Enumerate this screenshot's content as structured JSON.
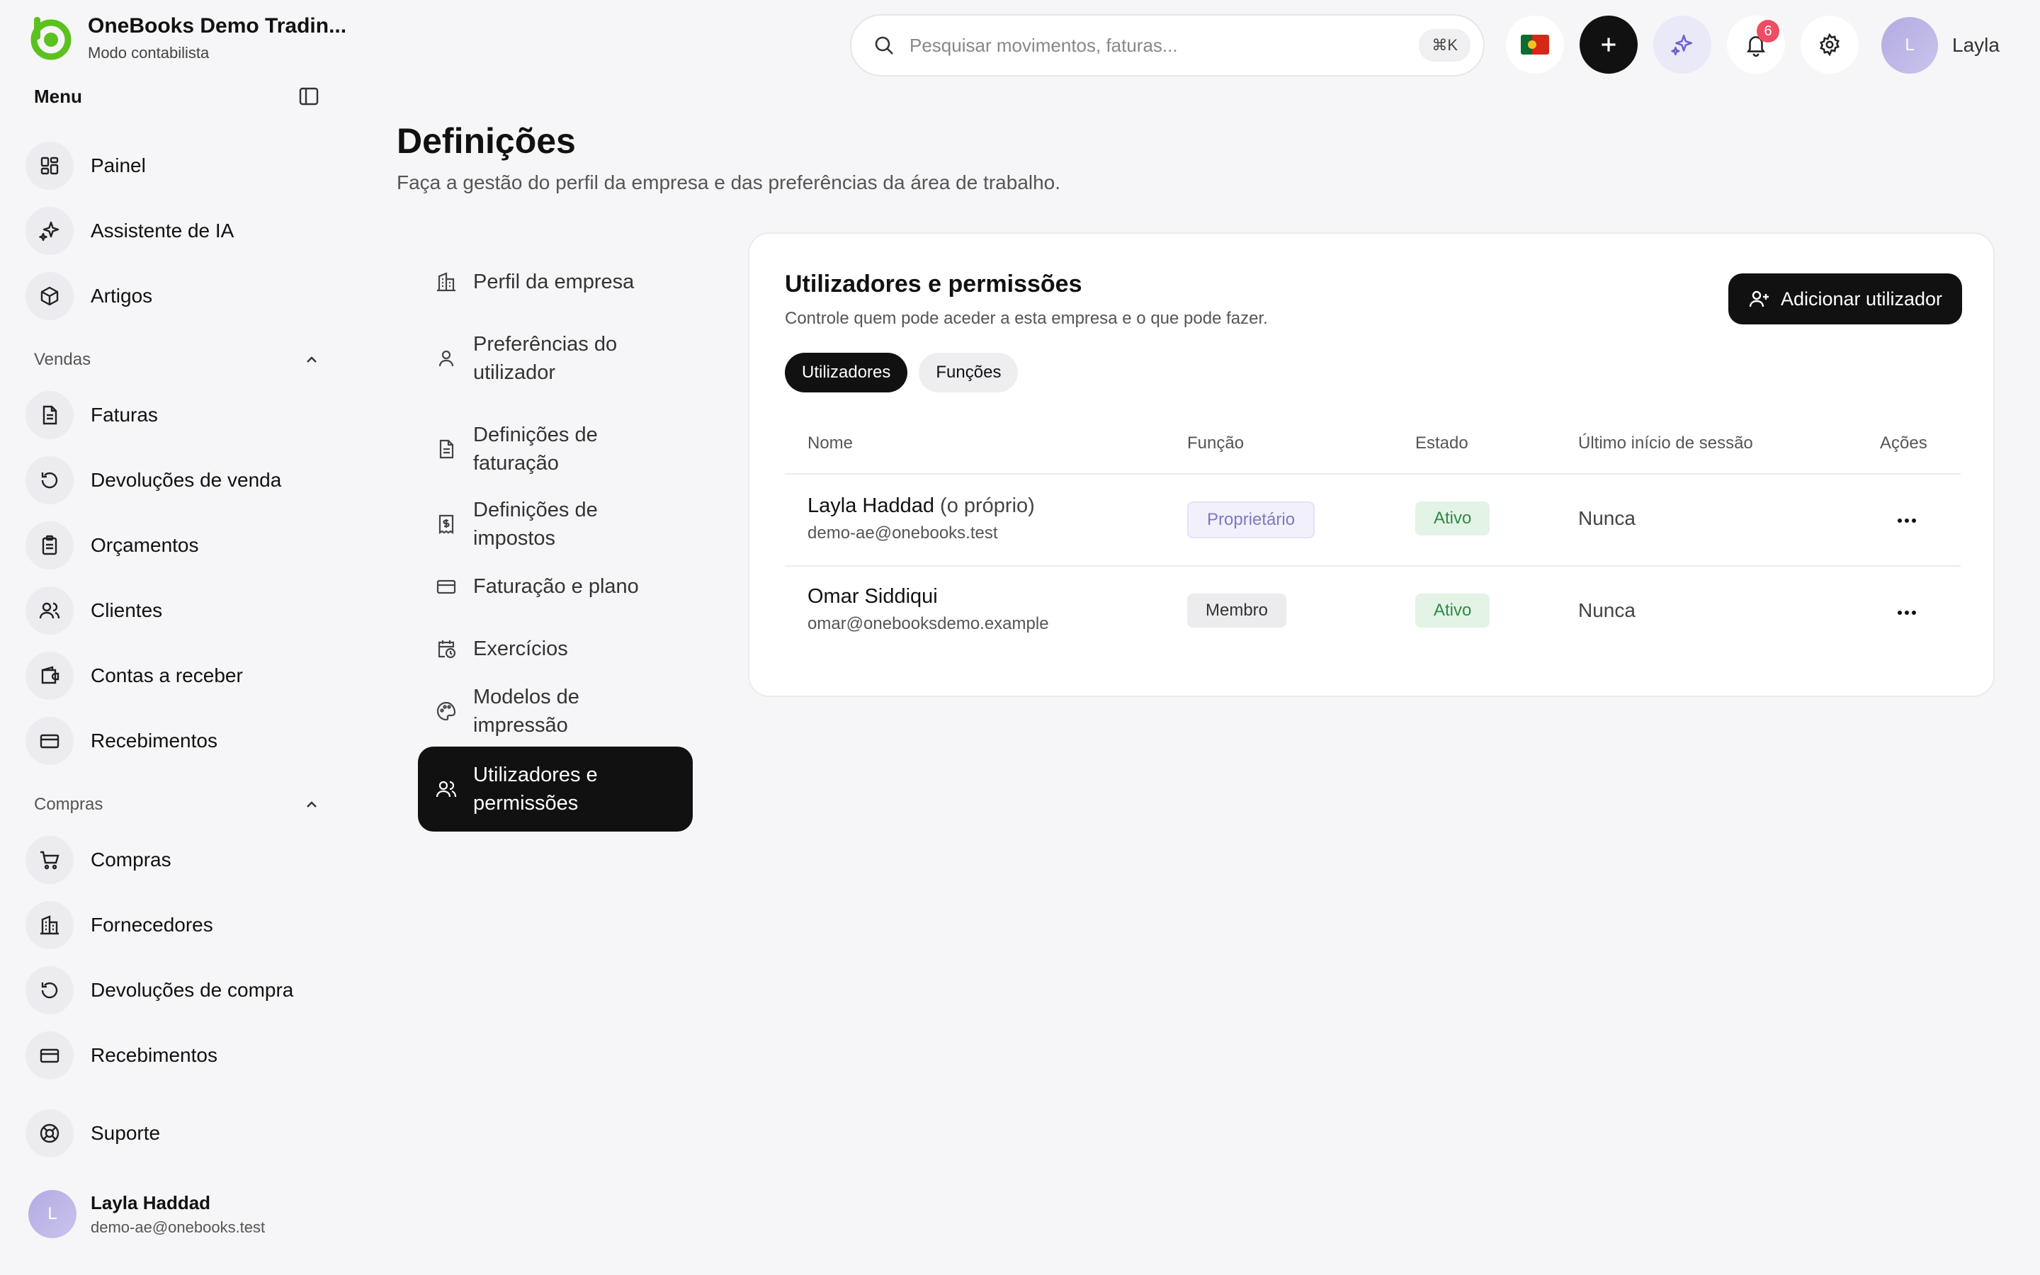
{
  "brand": {
    "name": "OneBooks Demo Tradin...",
    "subtitle": "Modo contabilista"
  },
  "sidebar": {
    "menu_title": "Menu",
    "top_items": [
      {
        "label": "Painel",
        "icon": "dashboard-icon"
      },
      {
        "label": "Assistente de IA",
        "icon": "sparkles-icon"
      },
      {
        "label": "Artigos",
        "icon": "box-icon"
      }
    ],
    "sales": {
      "label": "Vendas",
      "items": [
        {
          "label": "Faturas",
          "icon": "document-icon"
        },
        {
          "label": "Devoluções de venda",
          "icon": "rotate-icon"
        },
        {
          "label": "Orçamentos",
          "icon": "clipboard-icon"
        },
        {
          "label": "Clientes",
          "icon": "users-icon"
        },
        {
          "label": "Contas a receber",
          "icon": "wallet-icon"
        },
        {
          "label": "Recebimentos",
          "icon": "card-icon"
        }
      ]
    },
    "purchases": {
      "label": "Compras",
      "items": [
        {
          "label": "Compras",
          "icon": "cart-icon"
        },
        {
          "label": "Fornecedores",
          "icon": "building-icon"
        },
        {
          "label": "Devoluções de compra",
          "icon": "rotate-icon"
        },
        {
          "label": "Recebimentos",
          "icon": "card-icon"
        }
      ]
    },
    "support": {
      "label": "Suporte",
      "icon": "lifebuoy-icon"
    },
    "user": {
      "initial": "L",
      "name": "Layla Haddad",
      "email": "demo-ae@onebooks.test"
    }
  },
  "topbar": {
    "search_placeholder": "Pesquisar movimentos, faturas...",
    "shortcut": "⌘K",
    "notification_count": "6",
    "user_initial": "L",
    "user_name": "Layla"
  },
  "page": {
    "title": "Definições",
    "subtitle": "Faça a gestão do perfil da empresa e das preferências da área de trabalho."
  },
  "settings_nav": [
    {
      "label": "Perfil da empresa"
    },
    {
      "label": "Preferências do utilizador"
    },
    {
      "label": "Definições de faturação"
    },
    {
      "label": "Definições de impostos"
    },
    {
      "label": "Faturação e plano"
    },
    {
      "label": "Exercícios"
    },
    {
      "label": "Modelos de impressão"
    },
    {
      "label": "Utilizadores e permissões"
    }
  ],
  "users_card": {
    "title": "Utilizadores e permissões",
    "subtitle": "Controle quem pode aceder a esta empresa e o que pode fazer.",
    "add_button": "Adicionar utilizador",
    "tabs": [
      "Utilizadores",
      "Funções"
    ],
    "columns": [
      "Nome",
      "Função",
      "Estado",
      "Último início de sessão",
      "Ações"
    ],
    "rows": [
      {
        "name": "Layla Haddad",
        "owner_note": "(o próprio)",
        "email": "demo-ae@onebooks.test",
        "role": "Proprietário",
        "status": "Ativo",
        "last_login": "Nunca"
      },
      {
        "name": "Omar Siddiqui",
        "owner_note": "",
        "email": "omar@onebooksdemo.example",
        "role": "Membro",
        "status": "Ativo",
        "last_login": "Nunca"
      }
    ]
  },
  "colors": {
    "accent": "#111111",
    "brand_green": "#5bc11e",
    "badge": "#ef4d63",
    "active_status": "#2f8a45"
  }
}
